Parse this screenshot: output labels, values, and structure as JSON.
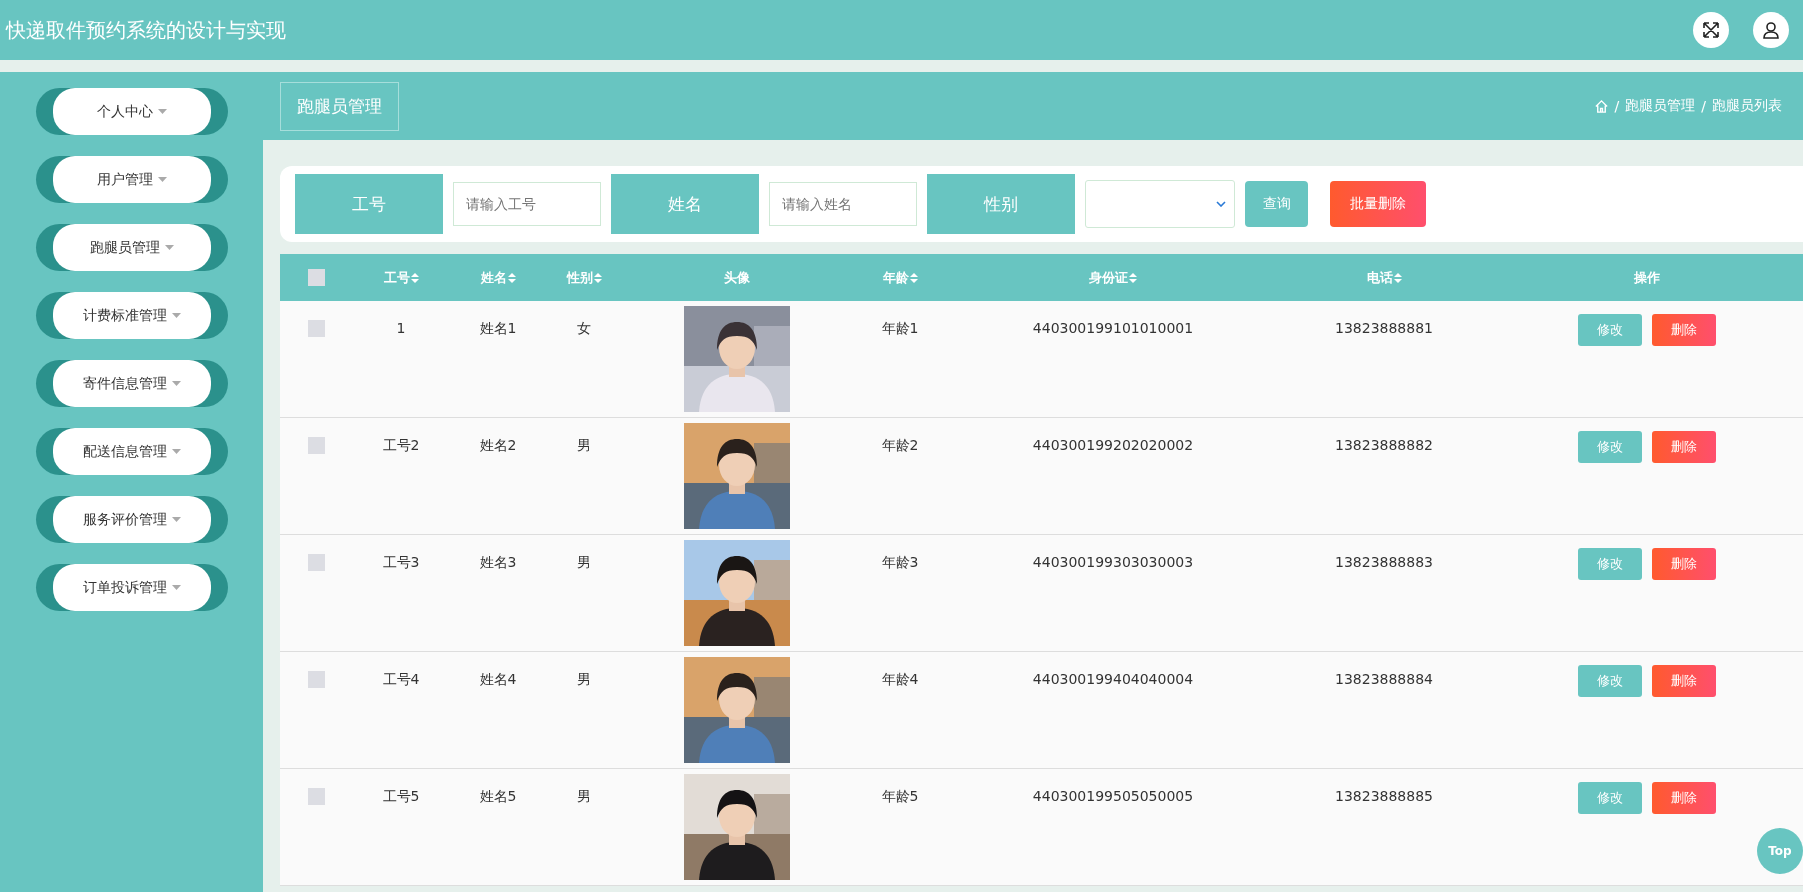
{
  "header": {
    "title": "快递取件预约系统的设计与实现"
  },
  "sidebar": {
    "items": [
      {
        "label": "个人中心"
      },
      {
        "label": "用户管理"
      },
      {
        "label": "跑腿员管理"
      },
      {
        "label": "计费标准管理"
      },
      {
        "label": "寄件信息管理"
      },
      {
        "label": "配送信息管理"
      },
      {
        "label": "服务评价管理"
      },
      {
        "label": "订单投诉管理"
      }
    ]
  },
  "page_title": "跑腿员管理",
  "breadcrumb": [
    {
      "separator": "/",
      "label": "跑腿员管理"
    },
    {
      "separator": "/",
      "label": "跑腿员列表"
    }
  ],
  "search": {
    "fields": [
      {
        "label": "工号",
        "kind": "text",
        "placeholder": "请输入工号"
      },
      {
        "label": "姓名",
        "kind": "text",
        "placeholder": "请输入姓名"
      },
      {
        "label": "性别",
        "kind": "select"
      }
    ],
    "query_button": "查询",
    "batch_delete_button": "批量删除"
  },
  "table": {
    "select_all_checked": false,
    "columns": [
      {
        "label": "工号",
        "sortable": true
      },
      {
        "label": "姓名",
        "sortable": true
      },
      {
        "label": "性别",
        "sortable": true
      },
      {
        "label": "头像",
        "sortable": false
      },
      {
        "label": "年龄",
        "sortable": true
      },
      {
        "label": "身份证",
        "sortable": true
      },
      {
        "label": "电话",
        "sortable": true
      },
      {
        "label": "操作",
        "sortable": false
      }
    ],
    "rows": [
      {
        "checked": false,
        "cells": [
          "1",
          "姓名1",
          "女",
          {
            "kind": "picture"
          },
          "年龄1",
          "440300199101010001",
          "13823888881"
        ],
        "actions": [
          "修改",
          "删除"
        ]
      },
      {
        "checked": false,
        "cells": [
          "工号2",
          "姓名2",
          "男",
          {
            "kind": "picture"
          },
          "年龄2",
          "440300199202020002",
          "13823888882"
        ],
        "actions": [
          "修改",
          "删除"
        ]
      },
      {
        "checked": false,
        "cells": [
          "工号3",
          "姓名3",
          "男",
          {
            "kind": "picture"
          },
          "年龄3",
          "440300199303030003",
          "13823888883"
        ],
        "actions": [
          "修改",
          "删除"
        ]
      },
      {
        "checked": false,
        "cells": [
          "工号4",
          "姓名4",
          "男",
          {
            "kind": "picture"
          },
          "年龄4",
          "440300199404040004",
          "13823888884"
        ],
        "actions": [
          "修改",
          "删除"
        ]
      },
      {
        "checked": false,
        "cells": [
          "工号5",
          "姓名5",
          "男",
          {
            "kind": "picture"
          },
          "年龄5",
          "440300199505050005",
          "13823888885"
        ],
        "actions": [
          "修改",
          "删除"
        ]
      }
    ]
  },
  "top_button": "Top"
}
